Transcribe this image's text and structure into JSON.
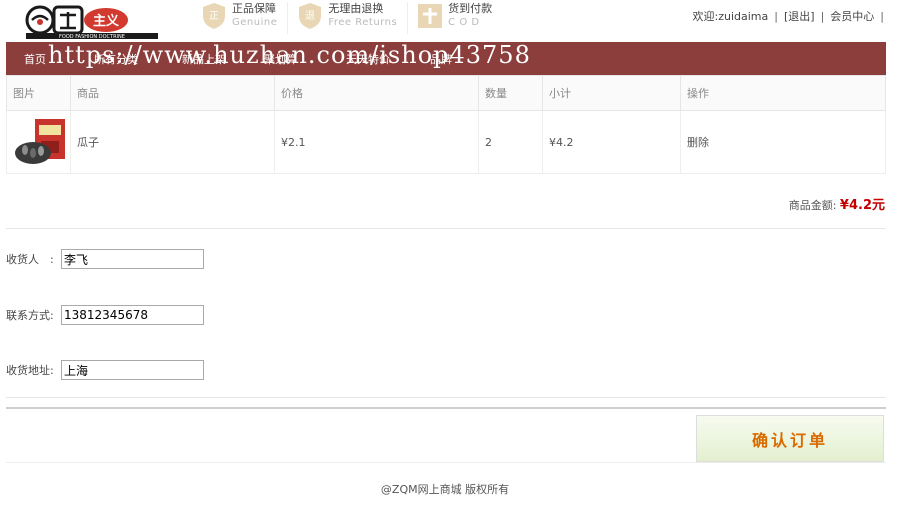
{
  "header": {
    "logo": {
      "brand_text": "主义",
      "tagline": "FOOD FASHION DOCTRINE"
    },
    "badges": [
      {
        "title": "正品保障",
        "subtitle": "Genuine",
        "icon": "genuine-icon"
      },
      {
        "title": "无理由退换",
        "subtitle": "Free Returns",
        "icon": "return-icon"
      },
      {
        "title": "货到付款",
        "subtitle": "C O D",
        "icon": "cod-icon"
      }
    ],
    "user": {
      "welcome": "欢迎:zuidaima",
      "logout": "[退出]",
      "member_center": "会员中心"
    }
  },
  "nav": {
    "items": [
      "首页",
      "所有分类",
      "新品上架",
      "聚划算",
      "天天特价",
      "品牌"
    ],
    "watermark": "https://www.huzhan.com/ishop43758"
  },
  "cart": {
    "headers": [
      "图片",
      "商品",
      "价格",
      "数量",
      "小计",
      "操作"
    ],
    "rows": [
      {
        "name": "瓜子",
        "price": "¥2.1",
        "qty": "2",
        "subtotal": "¥4.2",
        "action": "删除"
      }
    ],
    "total_label": "商品金额:",
    "total_value": "¥4.2元"
  },
  "form": {
    "receiver_label": "收货人　:",
    "receiver_value": "李飞",
    "phone_label": "联系方式:",
    "phone_value": "13812345678",
    "address_label": "收货地址:",
    "address_value": "上海"
  },
  "confirm_label": "确认订单",
  "footer": "@ZQM网上商城 版权所有",
  "colors": {
    "nav": "#8b3e3c",
    "price": "#c40000",
    "confirm_text": "#d96a00"
  }
}
